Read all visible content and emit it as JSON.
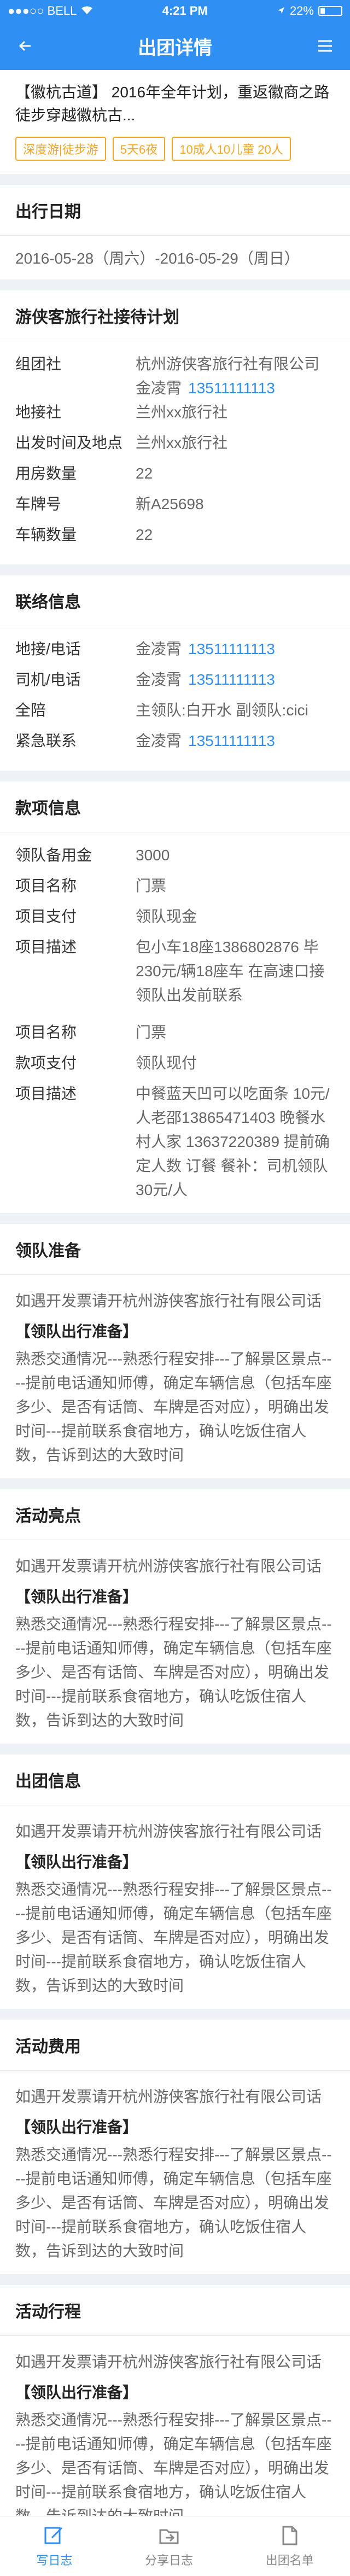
{
  "status": {
    "carrier": "●●●○○ BELL",
    "time": "4:21 PM",
    "battery": "22%"
  },
  "nav": {
    "title": "出团详情"
  },
  "header": {
    "title": "【徽杭古道】 2016年全年计划，重返徽商之路徒步穿越徽杭古...",
    "tags": [
      "深度游|徒步游",
      "5天6夜",
      "10成人10儿童 20人"
    ]
  },
  "travel_date": {
    "title": "出行日期",
    "value": "2016-05-28（周六）-2016-05-29（周日）"
  },
  "plan": {
    "title": "游侠客旅行社接待计划",
    "rows": [
      {
        "k": "组团社",
        "v": "杭州游侠客旅行社有限公司",
        "v2": "金凌霄",
        "phone": "13511111113"
      },
      {
        "k": "地接社",
        "v": "兰州xx旅行社"
      },
      {
        "k": "出发时间及地点",
        "v": "兰州xx旅行社"
      },
      {
        "k": "用房数量",
        "v": "22"
      },
      {
        "k": "车牌号",
        "v": "新A25698"
      },
      {
        "k": "车辆数量",
        "v": "22"
      }
    ]
  },
  "contact": {
    "title": "联络信息",
    "rows": [
      {
        "k": "地接/电话",
        "v": "金凌霄",
        "phone": "13511111113"
      },
      {
        "k": "司机/电话",
        "v": "金凌霄",
        "phone": "13511111113"
      },
      {
        "k": "全陪",
        "v": "主领队:白开水   副领队:cici"
      },
      {
        "k": "紧急联系",
        "v": "金凌霄",
        "phone": "13511111113"
      }
    ]
  },
  "payment": {
    "title": "款项信息",
    "rows": [
      {
        "k": "领队备用金",
        "v": "3000"
      },
      {
        "k": "项目名称",
        "v": "门票"
      },
      {
        "k": "项目支付",
        "v": "领队现金"
      },
      {
        "k": "项目描述",
        "v": "包小车18座1386802876 毕230元/辆18座车 在高速口接领队出发前联系"
      }
    ],
    "rows2": [
      {
        "k": "项目名称",
        "v": "门票"
      },
      {
        "k": "款项支付",
        "v": "领队现付"
      },
      {
        "k": "项目描述",
        "v": "中餐蓝天凹可以吃面条 10元/人老邵13865471403 晚餐水村人家 13637220389 提前确定人数 订餐 餐补：司机领队30元/人"
      }
    ]
  },
  "sections": [
    {
      "title": "领队准备",
      "intro": "如遇开发票请开杭州游侠客旅行社有限公司话",
      "sub": "【领队出行准备】",
      "note": "熟悉交通情况---熟悉行程安排---了解景区景点----提前电话通知师傅，确定车辆信息（包括车座多少、是否有话筒、车牌是否对应），明确出发时间---提前联系食宿地方，确认吃饭住宿人数，告诉到达的大致时间"
    },
    {
      "title": "活动亮点",
      "intro": "如遇开发票请开杭州游侠客旅行社有限公司话",
      "sub": "【领队出行准备】",
      "note": "熟悉交通情况---熟悉行程安排---了解景区景点----提前电话通知师傅，确定车辆信息（包括车座多少、是否有话筒、车牌是否对应），明确出发时间---提前联系食宿地方，确认吃饭住宿人数，告诉到达的大致时间"
    },
    {
      "title": "出团信息",
      "intro": "如遇开发票请开杭州游侠客旅行社有限公司话",
      "sub": "【领队出行准备】",
      "note": "熟悉交通情况---熟悉行程安排---了解景区景点----提前电话通知师傅，确定车辆信息（包括车座多少、是否有话筒、车牌是否对应），明确出发时间---提前联系食宿地方，确认吃饭住宿人数，告诉到达的大致时间"
    },
    {
      "title": "活动费用",
      "intro": "如遇开发票请开杭州游侠客旅行社有限公司话",
      "sub": "【领队出行准备】",
      "note": "熟悉交通情况---熟悉行程安排---了解景区景点----提前电话通知师傅，确定车辆信息（包括车座多少、是否有话筒、车牌是否对应），明确出发时间---提前联系食宿地方，确认吃饭住宿人数，告诉到达的大致时间"
    },
    {
      "title": "活动行程",
      "intro": "如遇开发票请开杭州游侠客旅行社有限公司话",
      "sub": "【领队出行准备】",
      "note": "熟悉交通情况---熟悉行程安排---了解景区景点----提前电话通知师傅，确定车辆信息（包括车座多少、是否有话筒、车牌是否对应），明确出发时间---提前联系食宿地方，确认吃饭住宿人数，告诉到达的大致时间"
    }
  ],
  "footer": {
    "tabs": [
      "写日志",
      "分享日志",
      "出团名单"
    ]
  },
  "colors": {
    "primary": "#2f8ff2",
    "tag": "#f5a623"
  }
}
